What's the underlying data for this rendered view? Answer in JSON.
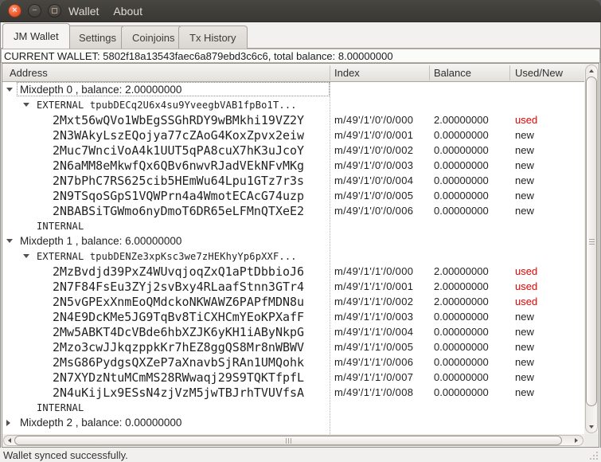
{
  "titlebar": {
    "menus": [
      {
        "label": "Wallet"
      },
      {
        "label": "About"
      }
    ]
  },
  "icons": {
    "close": "×",
    "minimize": "−",
    "maximize": "▢",
    "expander_open": "▼",
    "expander_closed": "▶",
    "scroll_up": "▲",
    "scroll_down": "▼",
    "scroll_left": "◀",
    "scroll_right": "▶"
  },
  "tabs": [
    {
      "label": "JM Wallet",
      "active": true
    },
    {
      "label": "Settings",
      "active": false
    },
    {
      "label": "Coinjoins",
      "active": false
    },
    {
      "label": "Tx History",
      "active": false
    }
  ],
  "wallet_banner": "CURRENT WALLET: 5802f18a13543faec6a879ebd3c6c6, total balance: 8.00000000",
  "tree": {
    "columns": [
      {
        "label": "Address"
      },
      {
        "label": "Index"
      },
      {
        "label": "Balance"
      },
      {
        "label": "Used/New"
      }
    ],
    "rows": [
      {
        "type": "mixdepth",
        "expander": "open",
        "focused": true,
        "label": "Mixdepth 0 , balance: 2.00000000"
      },
      {
        "type": "branch",
        "expander": "open",
        "label": "EXTERNAL tpubDECq2U6x4su9YveegbVAB1fpBo1T..."
      },
      {
        "type": "address",
        "label": "2Mxt56wQVo1WbEgSSGhRDY9wBMkhi19VZ2Y",
        "index": "m/49'/1'/0'/0/000",
        "balance": "2.00000000",
        "status": "used"
      },
      {
        "type": "address",
        "label": "2N3WAkyLszEQojya77cZAoG4KoxZpvx2eiw",
        "index": "m/49'/1'/0'/0/001",
        "balance": "0.00000000",
        "status": "new"
      },
      {
        "type": "address",
        "label": "2Muc7WnciVoA4k1UUT5qPA8cuX7hK3uJcoY",
        "index": "m/49'/1'/0'/0/002",
        "balance": "0.00000000",
        "status": "new"
      },
      {
        "type": "address",
        "label": "2N6aMM8eMkwfQx6QBv6nwvRJadVEkNFvMKg",
        "index": "m/49'/1'/0'/0/003",
        "balance": "0.00000000",
        "status": "new"
      },
      {
        "type": "address",
        "label": "2N7bPhC7RS625cib5HEmWu64Lpu1GTz7r3s",
        "index": "m/49'/1'/0'/0/004",
        "balance": "0.00000000",
        "status": "new"
      },
      {
        "type": "address",
        "label": "2N9TSqoSGpS1VQWPrn4a4WmotECAcG74uzp",
        "index": "m/49'/1'/0'/0/005",
        "balance": "0.00000000",
        "status": "new"
      },
      {
        "type": "address",
        "label": "2NBABSiTGWmo6nyDmoT6DR65eLFMnQTXeE2",
        "index": "m/49'/1'/0'/0/006",
        "balance": "0.00000000",
        "status": "new"
      },
      {
        "type": "branch",
        "expander": null,
        "label": "INTERNAL"
      },
      {
        "type": "mixdepth",
        "expander": "open",
        "label": "Mixdepth 1 , balance: 6.00000000"
      },
      {
        "type": "branch",
        "expander": "open",
        "label": "EXTERNAL tpubDENZe3xpKsc3we7zHEKhyYp6pXXF..."
      },
      {
        "type": "address",
        "label": "2MzBvdjd39PxZ4WUvqjoqZxQ1aPtDbbioJ6",
        "index": "m/49'/1'/1'/0/000",
        "balance": "2.00000000",
        "status": "used"
      },
      {
        "type": "address",
        "label": "2N7F84FsEu3ZYj2svBxy4RLaafStnn3GTr4",
        "index": "m/49'/1'/1'/0/001",
        "balance": "2.00000000",
        "status": "used"
      },
      {
        "type": "address",
        "label": "2N5vGPExXnmEoQMdckoNKWAWZ6PAPfMDN8u",
        "index": "m/49'/1'/1'/0/002",
        "balance": "2.00000000",
        "status": "used"
      },
      {
        "type": "address",
        "label": "2N4E9DcKMe5JG9TqBv8TiCXHCmYEoKPXafF",
        "index": "m/49'/1'/1'/0/003",
        "balance": "0.00000000",
        "status": "new"
      },
      {
        "type": "address",
        "label": "2Mw5ABKT4DcVBde6hbXZJK6yKH1iAByNkpG",
        "index": "m/49'/1'/1'/0/004",
        "balance": "0.00000000",
        "status": "new"
      },
      {
        "type": "address",
        "label": "2Mzo3cwJJkqzppkKr7hEZ8ggQS8Mr8nWBWV",
        "index": "m/49'/1'/1'/0/005",
        "balance": "0.00000000",
        "status": "new"
      },
      {
        "type": "address",
        "label": "2MsG86PydgsQXZeP7aXnavbSjRAn1UMQohk",
        "index": "m/49'/1'/1'/0/006",
        "balance": "0.00000000",
        "status": "new"
      },
      {
        "type": "address",
        "label": "2N7XYDzNtuMCmMS28RWwaqj29S9TQKTfpfL",
        "index": "m/49'/1'/1'/0/007",
        "balance": "0.00000000",
        "status": "new"
      },
      {
        "type": "address",
        "label": "2N4uKijLx9ESsN4zjVzM5jwTBJrhTVUVfsA",
        "index": "m/49'/1'/1'/0/008",
        "balance": "0.00000000",
        "status": "new"
      },
      {
        "type": "branch",
        "expander": null,
        "label": "INTERNAL"
      },
      {
        "type": "mixdepth",
        "expander": "closed",
        "label": "Mixdepth 2 , balance: 0.00000000"
      }
    ]
  },
  "statusbar": {
    "text": "Wallet synced successfully."
  },
  "colors": {
    "titlebar_bg": "#3c3a36",
    "close_button": "#ef5e35",
    "used_status": "#e60000",
    "new_status": "#232323",
    "viewport_bg": "#ffffff",
    "window_bg": "#f2f1ef"
  }
}
